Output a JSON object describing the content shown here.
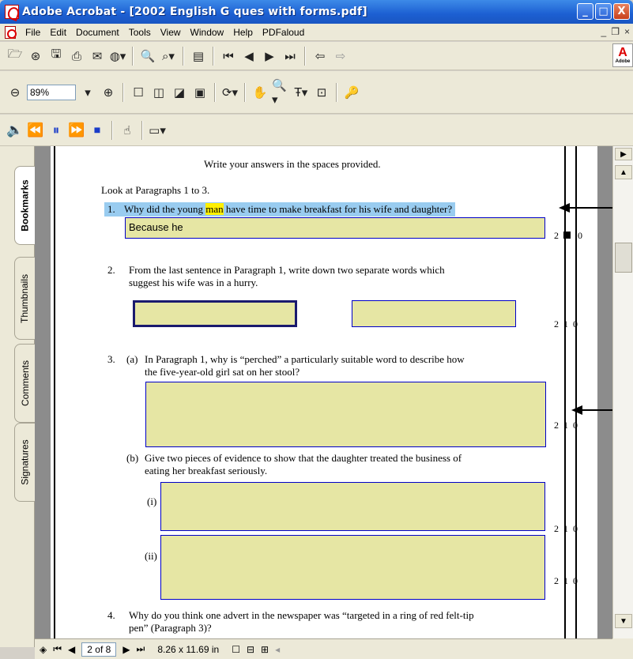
{
  "window": {
    "title": "Adobe Acrobat - [2002 English G ques with forms.pdf]",
    "minimize": "_",
    "maximize": "□",
    "close": "X"
  },
  "menu": {
    "items": [
      "File",
      "Edit",
      "Document",
      "Tools",
      "View",
      "Window",
      "Help",
      "PDFaloud"
    ],
    "doc_min": "_",
    "doc_restore": "❐",
    "doc_close": "×"
  },
  "toolbar": {
    "zoom_value": "89%",
    "adobe_logo": "A",
    "adobe_logo_small": "Adobe"
  },
  "side_tabs": [
    "Bookmarks",
    "Thumbnails",
    "Comments",
    "Signatures"
  ],
  "document": {
    "instruction": "Write your answers in the spaces provided.",
    "section": "Look at Paragraphs 1 to 3.",
    "q1": {
      "number": "1.",
      "text_before": "Why did the young ",
      "highlight_word": "man",
      "text_after": " have time to make breakfast for his wife and daughter?",
      "answer": "Because he",
      "marks": [
        "2",
        "0"
      ]
    },
    "q2": {
      "number": "2.",
      "line1": "From the last sentence in Paragraph 1, write down two separate words which",
      "line2": "suggest his wife was in a hurry.",
      "marks": [
        "2",
        "1",
        "0"
      ]
    },
    "q3a": {
      "number": "3.",
      "part": "(a)",
      "line1": "In Paragraph 1, why is “perched” a particularly suitable word to describe how",
      "line2": "the five-year-old girl sat on her stool?",
      "marks": [
        "2",
        "1",
        "0"
      ]
    },
    "q3b": {
      "part": "(b)",
      "line1": "Give two pieces of evidence to show that the daughter treated the business of",
      "line2": "eating her breakfast seriously.",
      "sub_i": "(i)",
      "sub_ii": "(ii)",
      "marks_i": [
        "2",
        "1",
        "0"
      ],
      "marks_ii": [
        "2",
        "1",
        "0"
      ]
    },
    "q4": {
      "number": "4.",
      "line1": "Why do you think one advert in the newspaper was “targeted in a ring of red felt-tip",
      "line2": "pen” (Paragraph 3)?"
    }
  },
  "status": {
    "page": "2 of 8",
    "size": "8.26 x 11.69 in"
  }
}
